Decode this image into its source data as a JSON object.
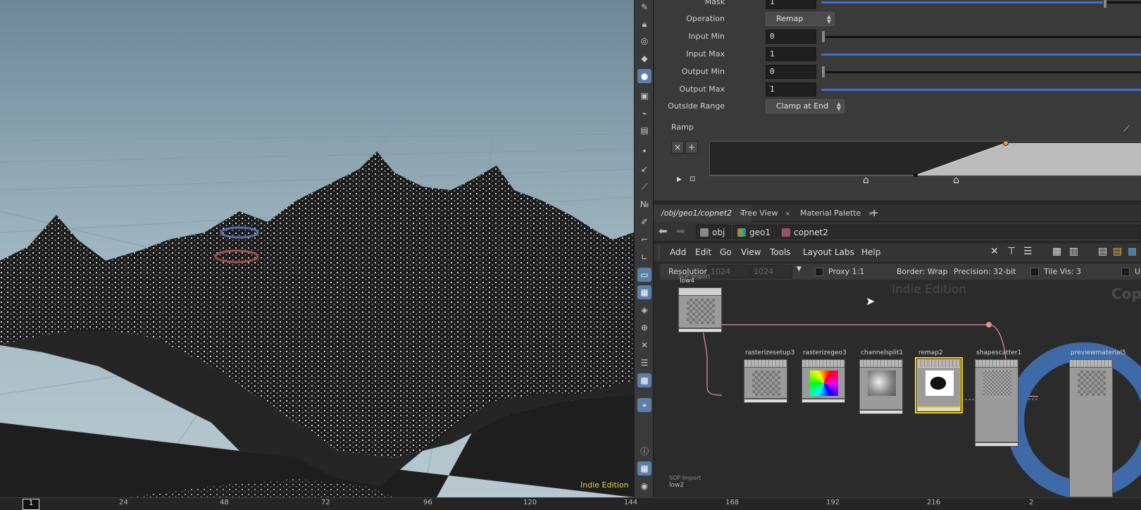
{
  "viewport": {
    "watermark": "Indie Edition"
  },
  "params": {
    "mask_label": "Mask",
    "mask_value": "1",
    "operation_label": "Operation",
    "operation_value": "Remap",
    "input_min_label": "Input Min",
    "input_min_value": "0",
    "input_max_label": "Input Max",
    "input_max_value": "1",
    "output_min_label": "Output Min",
    "output_min_value": "0",
    "output_max_label": "Output Max",
    "output_max_value": "1",
    "outside_range_label": "Outside Range",
    "outside_range_value": "Clamp at End",
    "ramp_label": "Ramp",
    "ramp_remove": "×",
    "ramp_add": "+"
  },
  "network": {
    "tabs": [
      {
        "label": "/obj/geo1/copnet2"
      },
      {
        "label": "Tree View"
      },
      {
        "label": "Material Palette"
      }
    ],
    "tab_close": "×",
    "tab_add": "+",
    "path": [
      "obj",
      "geo1",
      "copnet2"
    ],
    "menu": [
      "Add",
      "Edit",
      "Go",
      "View",
      "Tools",
      "Layout",
      "Labs",
      "Help"
    ],
    "info": {
      "resolution_label": "Resolution",
      "res_x": "1024",
      "res_y": "1024",
      "proxy": "Proxy 1:1",
      "border": "Border: Wrap",
      "precision": "Precision: 32-bit",
      "tile_vis": "Tile Vis: 3",
      "truncated": "U"
    },
    "watermark": "Indie Edition",
    "watermark2": "Cop",
    "nodes": {
      "low4_type": "SOP Import",
      "low4": "low4",
      "rasterizesetup3": "rasterizesetup3",
      "rasterizegeo3": "rasterizegeo3",
      "channelsplit1": "channelsplit1",
      "remap2": "remap2",
      "shapescatter1": "shapescatter1",
      "previewmaterial5": "previewmaterial5",
      "low2_type": "SOP Import",
      "low2": "low2"
    }
  },
  "timeline": {
    "current_frame": "1",
    "ticks": [
      "24",
      "48",
      "72",
      "96",
      "120",
      "144",
      "168",
      "192",
      "216",
      "2"
    ]
  }
}
